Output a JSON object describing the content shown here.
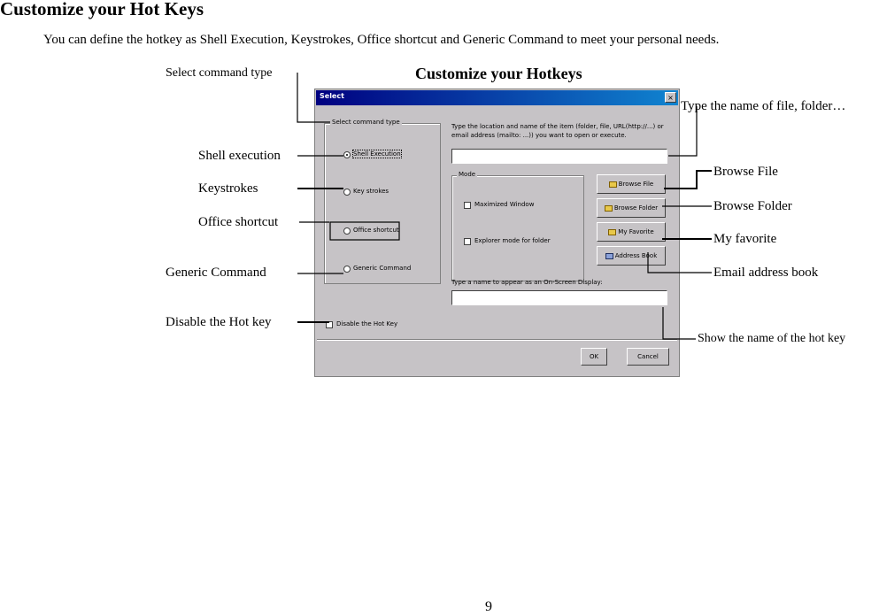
{
  "heading": "Customize your Hot Keys",
  "intro": "You can define the hotkey as Shell Execution, Keystrokes, Office shortcut and Generic Command to meet your personal needs.",
  "figure_title": "Customize your Hotkeys",
  "callouts": {
    "select_type": "Select command type",
    "shell_execution": "Shell execution",
    "keystrokes": "Keystrokes",
    "office_shortcut": "Office shortcut",
    "generic_command": "Generic Command",
    "disable_hotkey": "Disable the Hot key",
    "type_name": "Type the name of file, folder…",
    "browse_file": "Browse File",
    "browse_folder": "Browse Folder",
    "my_favorite": "My favorite",
    "email_book": "Email address book",
    "show_name": "Show the name of the hot key"
  },
  "dialog": {
    "title": "Select",
    "close_glyph": "×",
    "command_group_label": "Select command type",
    "radios": [
      "Shell Execution",
      "Key strokes",
      "Office shortcut",
      "Generic Command"
    ],
    "location_prompt_1": "Type the location and name of the item (folder, file, URL(http://...) or",
    "location_prompt_2": "email address (mailto: ...)) you want to open or execute.",
    "location_value": "",
    "mode_label": "Mode",
    "mode_options": [
      "Maximized Window",
      "Explorer mode for folder"
    ],
    "buttons": [
      "Browse File",
      "Browse Folder",
      "My Favorite",
      "Address Book"
    ],
    "osd_prompt": "Type a name to appear as an On-Screen Display:",
    "osd_value": "",
    "disable_label": "Disable the Hot Key",
    "ok": "OK",
    "cancel": "Cancel"
  },
  "page_number": "9"
}
